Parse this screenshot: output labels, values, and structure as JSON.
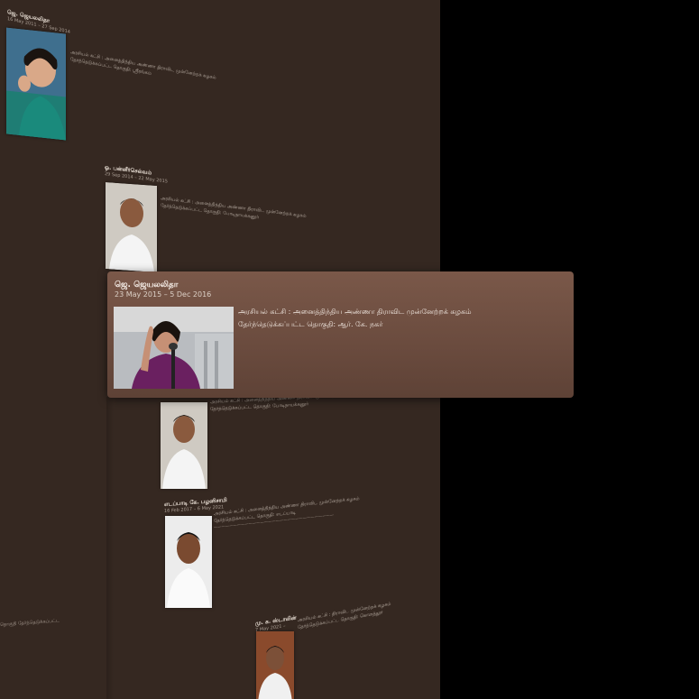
{
  "card": {
    "name": "ஜெ. ஜெயலலிதா",
    "dates": "23 May 2015 – 5 Dec 2016",
    "party_line": "அரசியல் கட்சி : அனைத்திந்திய அண்ணா திராவிட முன்னேற்றக் கழகம்",
    "constituency_line": "தேர்ந்தெடுக்கப்பட்ட தொகுதி: ஆர். கே. நகர்"
  },
  "entries": {
    "e1": {
      "name": "ஜெ. ஜெயலலிதா",
      "dates": "16 May 2011 – 27 Sep 2014",
      "line1": "அரசியல் கட்சி : அனைத்திந்திய அண்ணா திராவிட முன்னேற்றக் கழகம்",
      "line2": "தேர்ந்தெடுக்கப்பட்ட தொகுதி: ஸ்ரீரங்கம்"
    },
    "e2": {
      "name": "ஓ. பன்னீர்செல்வம்",
      "dates": "29 Sep 2014 – 22 May 2015",
      "line1": "அரசியல் கட்சி : அனைத்திந்திய அண்ணா திராவிட முன்னேற்றக் கழகம்",
      "line2": "தேர்ந்தெடுக்கப்பட்ட தொகுதி: போடிநாயக்கனூர்"
    },
    "e3": {
      "line1": "அரசியல் கட்சி : அனைத்திந்திய அண்ணா திராவிட முன்னேற்றக் கழகம்",
      "line2": "தேர்ந்தெடுக்கப்பட்ட தொகுதி: போடிநாயக்கனூர்"
    },
    "e4": {
      "name": "எடப்பாடி கே. பழனிசாமி",
      "dates": "16 Feb 2017 – 6 May 2021",
      "line1": "அரசியல் கட்சி : அனைத்திந்திய அண்ணா திராவிட முன்னேற்றக் கழகம்",
      "line2": "தேர்ந்தெடுக்கப்பட்ட தொகுதி: எடப்பாடி"
    },
    "e5": {
      "name": "மு. க. ஸ்டாலின்",
      "dates": "7 May 2021 –",
      "line1": "அரசியல் கட்சி : திராவிட முன்னேற்றக் கழகம்",
      "line2": "தேர்ந்தெடுக்கப்பட்ட தொகுதி: கொளத்தூர்"
    }
  },
  "edge_label": "தொகுதி தேர்ந்தெடுக்கப்பட்ட",
  "colors": {
    "wall": "#352821",
    "card": "#6d4e41",
    "outside": "#000000"
  }
}
